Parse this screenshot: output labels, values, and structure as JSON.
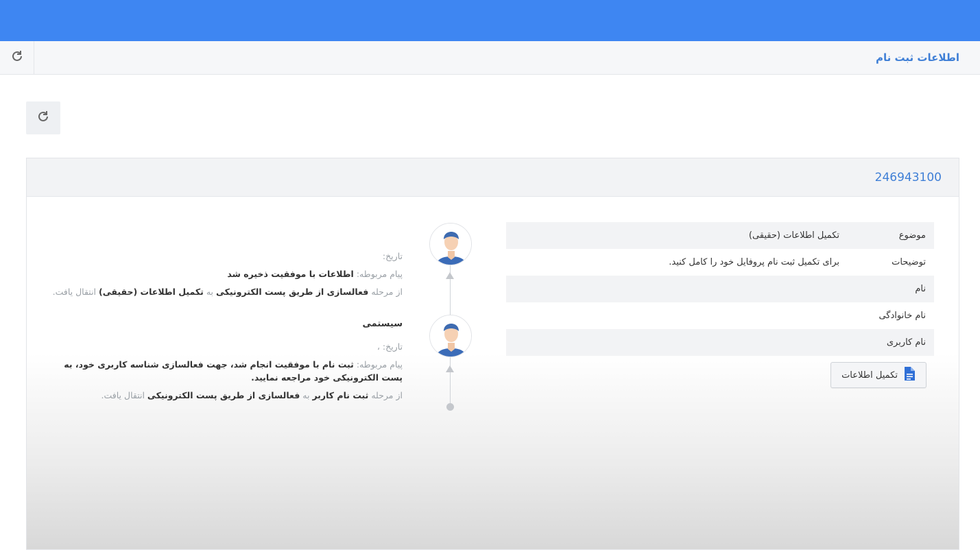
{
  "header": {
    "title": "اطلاعات ثبت نام",
    "refresh_icon": "refresh-icon"
  },
  "panel": {
    "id": "246943100",
    "info": [
      {
        "label": "موضوع",
        "value": "تکمیل اطلاعات (حقیقی)"
      },
      {
        "label": "توضیحات",
        "value": "برای تکمیل ثبت نام پروفایل خود را کامل کنید."
      },
      {
        "label": "نام",
        "value": ""
      },
      {
        "label": "نام خانوادگی",
        "value": ""
      },
      {
        "label": "نام کاربری",
        "value": ""
      }
    ],
    "complete_button": {
      "label": "تکمیل اطلاعات",
      "icon": "document-icon"
    }
  },
  "timeline": [
    {
      "sender": "",
      "date_label": "تاریخ:",
      "message_label": "پیام مربوطه:",
      "message": "اطلاعات با موفقیت ذخیره شد",
      "stage_prefix": "از مرحله",
      "stage_from": "فعالسازی از طریق پست الکترونیکی",
      "stage_to_word": "به",
      "stage_to": "تکمیل اطلاعات (حقیقی)",
      "stage_suffix": "انتقال یافت."
    },
    {
      "sender": "سیستمی",
      "date_label": "تاریخ: ،",
      "message_label": "پیام مربوطه:",
      "message": "ثبت نام با موفقیت انجام شد، جهت فعالسازی شناسه کاربری خود، به پست الکترونیکی خود مراجعه نمایید.",
      "stage_prefix": "از مرحله",
      "stage_from": "ثبت نام کاربر",
      "stage_to_word": "به",
      "stage_to": "فعالسازی از طریق پست الکترونیکی",
      "stage_suffix": "انتقال یافت."
    }
  ],
  "colors": {
    "topbar": "#3e86f2",
    "accent": "#3f7fd6"
  }
}
